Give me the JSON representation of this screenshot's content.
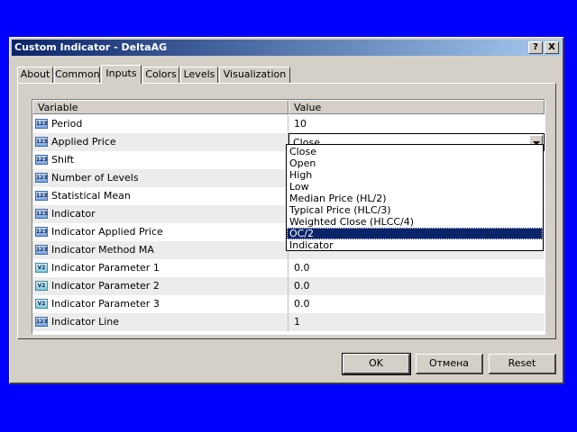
{
  "window": {
    "title": "Custom Indicator - DeltaAG",
    "help_label": "?",
    "close_label": "X"
  },
  "tabs": [
    {
      "label": "About"
    },
    {
      "label": "Common"
    },
    {
      "label": "Inputs"
    },
    {
      "label": "Colors"
    },
    {
      "label": "Levels"
    },
    {
      "label": "Visualization"
    }
  ],
  "active_tab": "Inputs",
  "grid": {
    "columns": [
      "Variable",
      "Value"
    ],
    "rows": [
      {
        "icon": "123",
        "name": "Period",
        "value": "10"
      },
      {
        "icon": "123",
        "name": "Applied Price",
        "value": "Close"
      },
      {
        "icon": "123",
        "name": "Shift",
        "value": ""
      },
      {
        "icon": "123",
        "name": "Number of Levels",
        "value": ""
      },
      {
        "icon": "123",
        "name": "Statistical Mean",
        "value": ""
      },
      {
        "icon": "123",
        "name": "Indicator",
        "value": ""
      },
      {
        "icon": "123",
        "name": "Indicator Applied Price",
        "value": ""
      },
      {
        "icon": "123",
        "name": "Indicator Method MA",
        "value": ""
      },
      {
        "icon": "V2",
        "name": "Indicator Parameter 1",
        "value": "0.0"
      },
      {
        "icon": "V2",
        "name": "Indicator Parameter 2",
        "value": "0.0"
      },
      {
        "icon": "V2",
        "name": "Indicator Parameter 3",
        "value": "0.0"
      },
      {
        "icon": "123",
        "name": "Indicator Line",
        "value": "1"
      }
    ]
  },
  "dropdown": {
    "options": [
      "Close",
      "Open",
      "High",
      "Low",
      "Median Price (HL/2)",
      "Typical Price (HLC/3)",
      "Weighted Close (HLCC/4)",
      "OC/2",
      "Indicator"
    ],
    "highlighted": "OC/2"
  },
  "buttons": {
    "ok": "OK",
    "cancel": "Отмена",
    "reset": "Reset"
  },
  "colors": {
    "desktop": "#0000ff",
    "titlebar": "#0a246a",
    "face": "#d4d0c8",
    "selection": "#0a246a"
  }
}
